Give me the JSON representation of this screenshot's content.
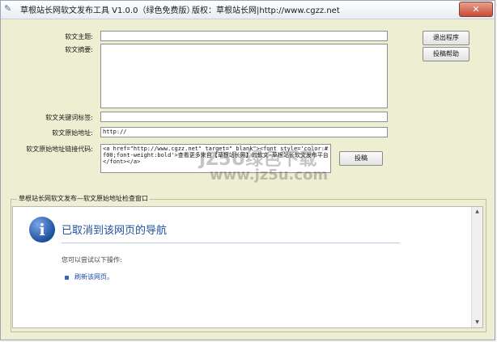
{
  "titlebar": {
    "app_icon": "app-icon",
    "title": "草根站长网软文发布工具 V1.0.0（绿色免费版）",
    "copyright": "版权：草根站长网|http://www.cgzz.net",
    "close_label": "✕"
  },
  "form": {
    "subject_label": "软文主题:",
    "summary_label": "软文摘要:",
    "keywords_label": "软文关键词标签:",
    "url_label": "软文原始地址:",
    "url_value": "http://",
    "link_code_label": "软文原始地址链接代码:",
    "link_code_value": "<a href=\"http://www.cgzz.net\" target=\"_blank\"><font style='color:#f00;font-weight:bold'>查看更多来自【草根站长网】的软文-草根站长软文发布平台</font></a>"
  },
  "buttons": {
    "exit": "退出程序",
    "help": "投稿帮助",
    "submit": "投稿"
  },
  "group": {
    "label": "草根站长网软文发布—软文原始地址检查窗口"
  },
  "browser": {
    "icon": "info-icon",
    "error_title": "已取消到该网页的导航",
    "hint": "您可以尝试以下操作:",
    "refresh_link": "刷新该网页。"
  },
  "watermark": {
    "line1": "JZ5U绿色下载",
    "line2": "www.jz5u.com"
  }
}
